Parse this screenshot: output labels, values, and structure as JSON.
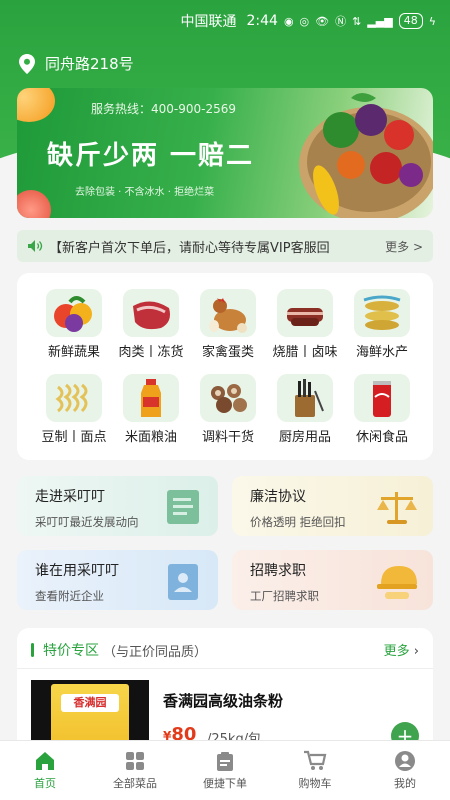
{
  "status": {
    "carrier": "中国联通",
    "time": "2:44",
    "network": "5G",
    "speed": "0\nK/s",
    "battery": "48"
  },
  "location": {
    "address": "同舟路218号"
  },
  "banner": {
    "hotline": "服务热线：400-900-2569",
    "slogan": "缺斤少两  一赔二",
    "subtitle": "去除包装 · 不含冰水 · 拒绝烂菜"
  },
  "notice": {
    "text": "【新客户首次下单后，请耐心等待专属VIP客服回",
    "more": "更多 >"
  },
  "categories": [
    {
      "label": "新鲜蔬果",
      "icon": "vegetables-icon"
    },
    {
      "label": "肉类丨冻货",
      "icon": "meat-icon"
    },
    {
      "label": "家禽蛋类",
      "icon": "poultry-icon"
    },
    {
      "label": "烧腊丨卤味",
      "icon": "cured-meat-icon"
    },
    {
      "label": "海鲜水产",
      "icon": "seafood-icon"
    },
    {
      "label": "豆制丨面点",
      "icon": "noodles-icon"
    },
    {
      "label": "米面粮油",
      "icon": "oil-icon"
    },
    {
      "label": "调料干货",
      "icon": "dried-goods-icon"
    },
    {
      "label": "厨房用品",
      "icon": "knives-icon"
    },
    {
      "label": "休闲食品",
      "icon": "snack-can-icon"
    }
  ],
  "cards": [
    {
      "title": "走进采叮叮",
      "subtitle": "采叮叮最近发展动向"
    },
    {
      "title": "廉洁协议",
      "subtitle": "价格透明 拒绝回扣"
    },
    {
      "title": "谁在用采叮叮",
      "subtitle": "查看附近企业"
    },
    {
      "title": "招聘求职",
      "subtitle": "工厂招聘求职"
    }
  ],
  "special": {
    "title": "特价专区",
    "note": "（与正价同品质）",
    "more": "更多",
    "product": {
      "name": "香满园高级油条粉",
      "price": "80",
      "currency": "¥",
      "unit": "/25kg/包",
      "brand_text": "香满园"
    }
  },
  "tabs": [
    {
      "label": "首页",
      "icon": "home-icon",
      "active": true
    },
    {
      "label": "全部菜品",
      "icon": "grid-icon",
      "active": false
    },
    {
      "label": "便捷下单",
      "icon": "clipboard-icon",
      "active": false
    },
    {
      "label": "购物车",
      "icon": "cart-icon",
      "active": false
    },
    {
      "label": "我的",
      "icon": "user-icon",
      "active": false
    }
  ],
  "colors": {
    "primary": "#2aa33f",
    "price": "#e23b1b"
  }
}
